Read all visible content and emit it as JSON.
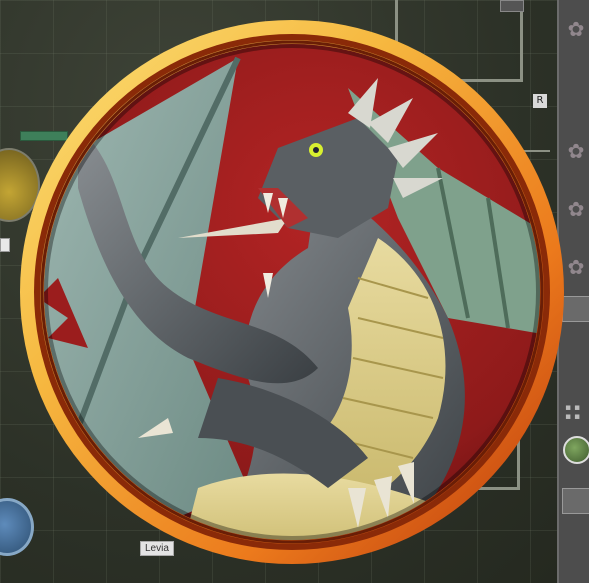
{
  "map": {
    "name_label": "Levia",
    "tag_label": "R"
  },
  "token": {
    "subject": "dragon-token",
    "ring_colors": [
      "#f7d25a",
      "#f08a1e",
      "#b8340c"
    ],
    "background_color": "#9b1d1d"
  },
  "sidebar": {
    "icons": [
      "flower-icon",
      "flower-icon",
      "flower-icon",
      "flower-icon"
    ]
  }
}
